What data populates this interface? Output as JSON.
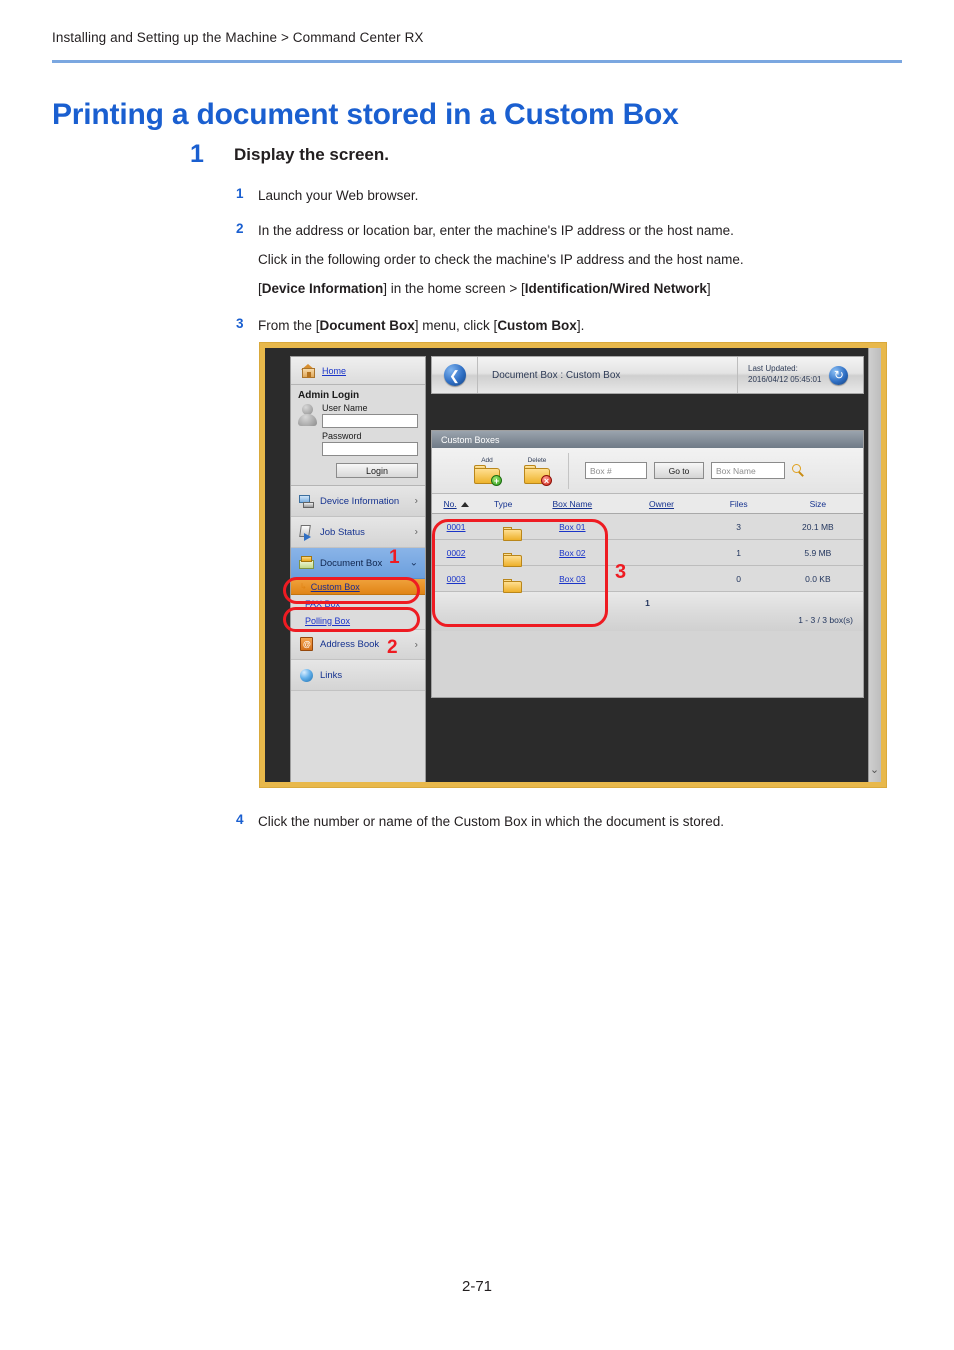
{
  "page": {
    "breadcrumb": "Installing and Setting up the Machine > Command Center RX",
    "title": "Printing a document stored in a Custom Box",
    "number": "2-71"
  },
  "step": {
    "number": "1",
    "title": "Display the screen.",
    "items": [
      {
        "marker": "1",
        "text": "Launch your Web browser."
      },
      {
        "marker": "2",
        "text": "In the address or location bar, enter the machine's IP address or the host name."
      },
      {
        "marker": "3",
        "text": "From the [Document Box] menu, click [Custom Box]."
      },
      {
        "marker": "4",
        "text": "Click the number or name of the Custom Box in which the document is stored."
      }
    ],
    "item2_line2": "Click in the following order to check the machine's IP address and the host name.",
    "item2_line3_pre": "[",
    "item2_line3_b1": "Device Information",
    "item2_line3_mid": "] in the home screen > [",
    "item2_line3_b2": "Identification/Wired Network",
    "item2_line3_post": "]",
    "item3_pre": "From the [",
    "item3_b1": "Document Box",
    "item3_mid": "] menu, click [",
    "item3_b2": "Custom Box",
    "item3_post": "]."
  },
  "screenshot": {
    "header": {
      "back_icon": "back-arrow-icon",
      "title": "Document Box : Custom Box",
      "updated_label": "Last Updated:",
      "updated_value": "2016/04/12 05:45:01",
      "refresh_icon": "refresh-icon"
    },
    "sidebar": {
      "home": "Home",
      "admin_login_title": "Admin Login",
      "user_name_label": "User Name",
      "user_name_value": "",
      "password_label": "Password",
      "password_value": "",
      "login_button": "Login",
      "nav": [
        {
          "label": "Device Information",
          "icon": "device-information-icon",
          "chevron": "›",
          "selected": false
        },
        {
          "label": "Job Status",
          "icon": "job-status-icon",
          "chevron": "›",
          "selected": false
        },
        {
          "label": "Document Box",
          "icon": "document-box-icon",
          "chevron": "⌄",
          "selected": true
        }
      ],
      "sub_nav": [
        {
          "label": "Custom Box",
          "selected": true
        },
        {
          "label": "FAX Box",
          "selected": false
        },
        {
          "label": "Polling Box",
          "selected": false
        }
      ],
      "nav_after": [
        {
          "label": "Address Book",
          "icon": "address-book-icon",
          "chevron": "›"
        },
        {
          "label": "Links",
          "icon": "links-icon",
          "chevron": ""
        }
      ]
    },
    "panel": {
      "heading": "Custom Boxes",
      "toolbar": {
        "add_label": "Add",
        "delete_label": "Delete",
        "box_number_placeholder": "Box #",
        "goto_button": "Go to",
        "box_name_placeholder": "Box Name",
        "search_icon": "magnifier-icon"
      },
      "table": {
        "columns": [
          "No.",
          "Type",
          "Box Name",
          "Owner",
          "Files",
          "Size"
        ],
        "sort_column": "No.",
        "rows": [
          {
            "no": "0001",
            "type": "folder-icon",
            "name": "Box 01",
            "owner": "",
            "files": "3",
            "size": "20.1 MB"
          },
          {
            "no": "0002",
            "type": "folder-icon",
            "name": "Box 02",
            "owner": "",
            "files": "1",
            "size": "5.9 MB"
          },
          {
            "no": "0003",
            "type": "folder-icon",
            "name": "Box 03",
            "owner": "",
            "files": "0",
            "size": "0.0 KB"
          }
        ]
      },
      "pager_current": "1",
      "pager_info": "1 - 3 / 3 box(s)"
    },
    "annotations": [
      {
        "label": "1"
      },
      {
        "label": "2"
      },
      {
        "label": "3"
      }
    ],
    "colors": {
      "annotation_red": "#ee1b22",
      "selected_nav_blue": "#7aa9e3",
      "selected_sub_orange": "#e89322",
      "frame_gold": "#e8b84b"
    }
  }
}
